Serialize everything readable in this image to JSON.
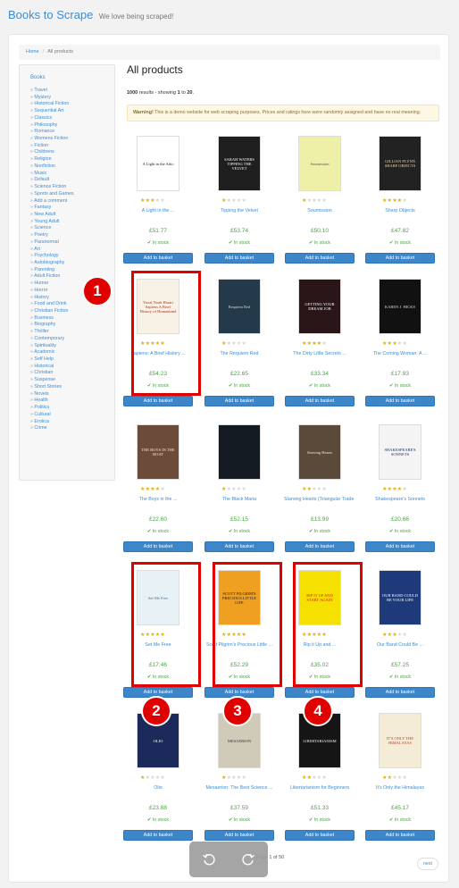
{
  "header": {
    "brand": "Books to Scrape",
    "tagline": "We love being scraped!"
  },
  "breadcrumb": {
    "home": "Home",
    "separator": "/",
    "current": "All products"
  },
  "sidebar": {
    "heading": "Books",
    "categories": [
      "Travel",
      "Mystery",
      "Historical Fiction",
      "Sequential Art",
      "Classics",
      "Philosophy",
      "Romance",
      "Womens Fiction",
      "Fiction",
      "Childrens",
      "Religion",
      "Nonfiction",
      "Music",
      "Default",
      "Science Fiction",
      "Sports and Games",
      "Add a comment",
      "Fantasy",
      "New Adult",
      "Young Adult",
      "Science",
      "Poetry",
      "Paranormal",
      "Art",
      "Psychology",
      "Autobiography",
      "Parenting",
      "Adult Fiction",
      "Humor",
      "Horror",
      "History",
      "Food and Drink",
      "Christian Fiction",
      "Business",
      "Biography",
      "Thriller",
      "Contemporary",
      "Spirituality",
      "Academic",
      "Self Help",
      "Historical",
      "Christian",
      "Suspense",
      "Short Stories",
      "Novels",
      "Health",
      "Politics",
      "Cultural",
      "Erotica",
      "Crime"
    ]
  },
  "main": {
    "title": "All products",
    "results": {
      "count": "1000",
      "prefix": "results - showing",
      "from": "1",
      "to_word": "to",
      "to": "20"
    },
    "warning": {
      "label": "Warning!",
      "text": "This is a demo website for web scraping purposes. Prices and ratings here were randomly assigned and have no real meaning."
    }
  },
  "products": [
    {
      "title": "A Light in the ...",
      "price": "£51.77",
      "rating": 3,
      "stock": "In stock",
      "button": "Add to basket",
      "cover_text": "A Light in the Attic",
      "cover_bg": "#ffffff",
      "cover_fg": "#222222"
    },
    {
      "title": "Tipping the Velvet",
      "price": "£53.74",
      "rating": 1,
      "stock": "In stock",
      "button": "Add to basket",
      "cover_text": "SARAH WATERS TIPPING THE VELVET",
      "cover_bg": "#1e1e1e",
      "cover_fg": "#ffffff"
    },
    {
      "title": "Soumission",
      "price": "£50.10",
      "rating": 1,
      "stock": "In stock",
      "button": "Add to basket",
      "cover_text": "Soumission",
      "cover_bg": "#eef0a8",
      "cover_fg": "#555555"
    },
    {
      "title": "Sharp Objects",
      "price": "£47.82",
      "rating": 4,
      "stock": "In stock",
      "button": "Add to basket",
      "cover_text": "GILLIAN FLYNN SHARP OBJECTS",
      "cover_bg": "#222222",
      "cover_fg": "#e8d9a0"
    },
    {
      "title": "Sapiens: A Brief History ...",
      "price": "£54.23",
      "rating": 5,
      "stock": "In stock",
      "button": "Add to basket",
      "cover_text": "Yuval Noah Harari Sapiens A Brief History of Humankind",
      "cover_bg": "#f7f1e6",
      "cover_fg": "#b3301f"
    },
    {
      "title": "The Requiem Red",
      "price": "£22.65",
      "rating": 1,
      "stock": "In stock",
      "button": "Add to basket",
      "cover_text": "Requiem Red",
      "cover_bg": "#243a4a",
      "cover_fg": "#c9d8e0"
    },
    {
      "title": "The Dirty Little Secrets ...",
      "price": "£33.34",
      "rating": 4,
      "stock": "In stock",
      "button": "Add to basket",
      "cover_text": "GETTING YOUR DREAM JOB",
      "cover_bg": "#2a1518",
      "cover_fg": "#ffffff"
    },
    {
      "title": "The Coming Woman: A ...",
      "price": "£17.93",
      "rating": 3,
      "stock": "In stock",
      "button": "Add to basket",
      "cover_text": "KAREN J. HICKS",
      "cover_bg": "#111111",
      "cover_fg": "#dddddd"
    },
    {
      "title": "The Boys in the ...",
      "price": "£22.60",
      "rating": 4,
      "stock": "In stock",
      "button": "Add to basket",
      "cover_text": "THE BOYS IN THE BOAT",
      "cover_bg": "#6d4b3a",
      "cover_fg": "#f4e6d3"
    },
    {
      "title": "The Black Maria",
      "price": "£52.15",
      "rating": 1,
      "stock": "In stock",
      "button": "Add to basket",
      "cover_text": "",
      "cover_bg": "#141a22",
      "cover_fg": "#9aa0a6"
    },
    {
      "title": "Starving Hearts (Triangular Trade ...",
      "price": "£13.99",
      "rating": 2,
      "stock": "In stock",
      "button": "Add to basket",
      "cover_text": "Starving Hearts",
      "cover_bg": "#5b4a3a",
      "cover_fg": "#f1e6d8"
    },
    {
      "title": "Shakespeare's Sonnets",
      "price": "£20.66",
      "rating": 4,
      "stock": "In stock",
      "button": "Add to basket",
      "cover_text": "SHAKESPEARE'S SONNETS",
      "cover_bg": "#f4f4f4",
      "cover_fg": "#1b2a6b"
    },
    {
      "title": "Set Me Free",
      "price": "£17.46",
      "rating": 5,
      "stock": "In stock",
      "button": "Add to basket",
      "cover_text": "Set Me Free",
      "cover_bg": "#e8f2f6",
      "cover_fg": "#4a6b82"
    },
    {
      "title": "Scott Pilgrim's Precious Little ...",
      "price": "£52.29",
      "rating": 5,
      "stock": "In stock",
      "button": "Add to basket",
      "cover_text": "SCOTT PILGRIM'S PRECIOUS LITTLE LIFE",
      "cover_bg": "#f0a020",
      "cover_fg": "#1a1a1a"
    },
    {
      "title": "Rip it Up and ...",
      "price": "£35.02",
      "rating": 5,
      "stock": "In stock",
      "button": "Add to basket",
      "cover_text": "RIP IT UP AND START AGAIN",
      "cover_bg": "#f5e000",
      "cover_fg": "#d21e1e"
    },
    {
      "title": "Our Band Could Be ...",
      "price": "£57.25",
      "rating": 3,
      "stock": "In stock",
      "button": "Add to basket",
      "cover_text": "OUR BAND COULD BE YOUR LIFE",
      "cover_bg": "#1e3a7a",
      "cover_fg": "#ffffff"
    },
    {
      "title": "Olio",
      "price": "£23.88",
      "rating": 1,
      "stock": "In stock",
      "button": "Add to basket",
      "cover_text": "OLIO",
      "cover_bg": "#1b2a5a",
      "cover_fg": "#ffffff"
    },
    {
      "title": "Mesaerion: The Best Science ...",
      "price": "£37.59",
      "rating": 1,
      "stock": "In stock",
      "button": "Add to basket",
      "cover_text": "MESAERION",
      "cover_bg": "#cfcbb8",
      "cover_fg": "#333333"
    },
    {
      "title": "Libertarianism for Beginners",
      "price": "£51.33",
      "rating": 2,
      "stock": "In stock",
      "button": "Add to basket",
      "cover_text": "LIBERTARIANISM",
      "cover_bg": "#151515",
      "cover_fg": "#f0f0f0"
    },
    {
      "title": "It's Only the Himalayas",
      "price": "£45.17",
      "rating": 2,
      "stock": "In stock",
      "button": "Add to basket",
      "cover_text": "IT'S ONLY THE HIMALAYAS",
      "cover_bg": "#f4ecd6",
      "cover_fg": "#c23b22"
    }
  ],
  "annotations": [
    {
      "label": "1",
      "product": 4
    },
    {
      "label": "2",
      "product": 12
    },
    {
      "label": "3",
      "product": 13
    },
    {
      "label": "4",
      "product": 14
    }
  ],
  "pager": {
    "text": "Page 1 of 50",
    "next": "next"
  },
  "colors": {
    "link": "#3d8cd2",
    "price": "#4ba345",
    "button": "#3c86c9",
    "star": "#e0b100",
    "annotation": "#e00000"
  }
}
